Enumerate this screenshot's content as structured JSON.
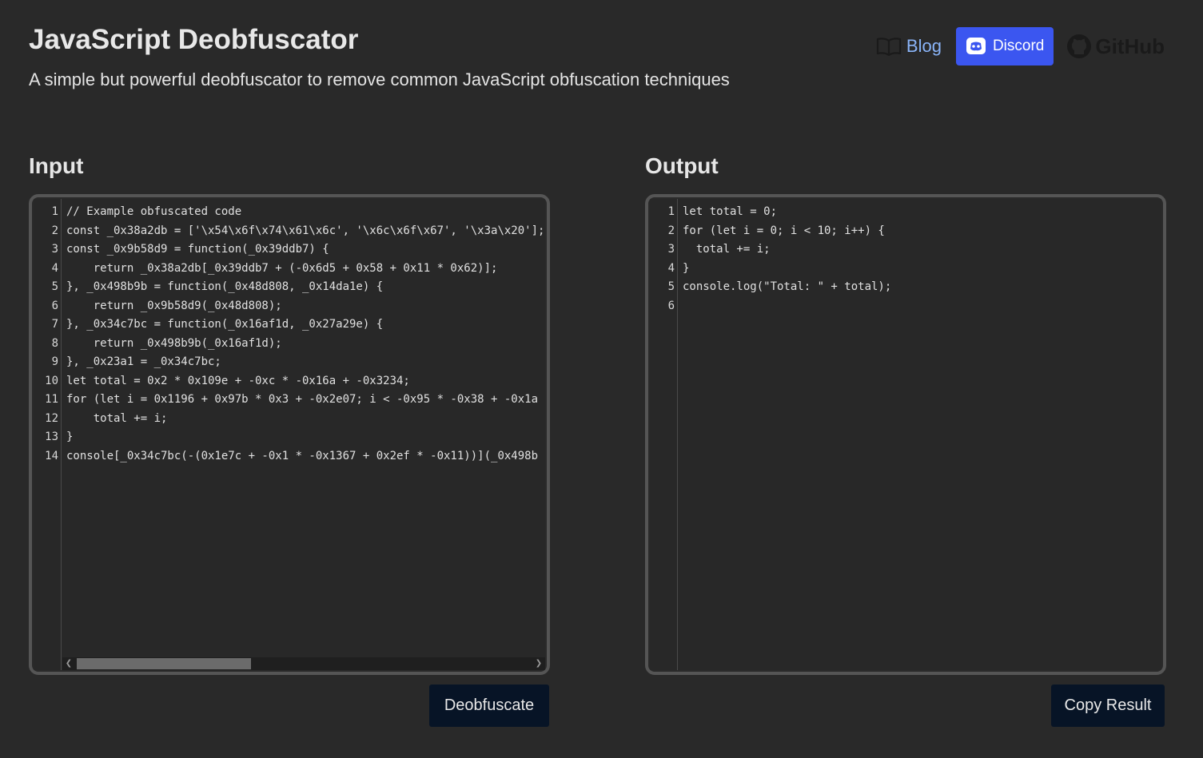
{
  "header": {
    "title": "JavaScript Deobfuscator",
    "subtitle": "A simple but powerful deobfuscator to remove common JavaScript obfuscation techniques"
  },
  "nav": {
    "blog_label": "Blog",
    "discord_label": "Discord",
    "github_label": "GitHub",
    "icons": [
      "book-icon",
      "discord-icon",
      "github-icon"
    ]
  },
  "input": {
    "label": "Input",
    "lines": [
      "// Example obfuscated code",
      "const _0x38a2db = ['\\x54\\x6f\\x74\\x61\\x6c', '\\x6c\\x6f\\x67', '\\x3a\\x20'];",
      "const _0x9b58d9 = function(_0x39ddb7) {",
      "    return _0x38a2db[_0x39ddb7 + (-0x6d5 + 0x58 + 0x11 * 0x62)];",
      "}, _0x498b9b = function(_0x48d808, _0x14da1e) {",
      "    return _0x9b58d9(_0x48d808);",
      "}, _0x34c7bc = function(_0x16af1d, _0x27a29e) {",
      "    return _0x498b9b(_0x16af1d);",
      "}, _0x23a1 = _0x34c7bc;",
      "let total = 0x2 * 0x109e + -0xc * -0x16a + -0x3234;",
      "for (let i = 0x1196 + 0x97b * 0x3 + -0x2e07; i < -0x95 * -0x38 + -0x1a",
      "    total += i;",
      "}",
      "console[_0x34c7bc(-(0x1e7c + -0x1 * -0x1367 + 0x2ef * -0x11))](_0x498b"
    ],
    "button_label": "Deobfuscate"
  },
  "output": {
    "label": "Output",
    "lines": [
      "let total = 0;",
      "for (let i = 0; i < 10; i++) {",
      "  total += i;",
      "}",
      "console.log(\"Total: \" + total);",
      ""
    ],
    "button_label": "Copy Result"
  },
  "colors": {
    "background": "#292929",
    "accent_link": "#8ab4f8",
    "discord": "#3b56f0",
    "button_bg": "#071426"
  }
}
